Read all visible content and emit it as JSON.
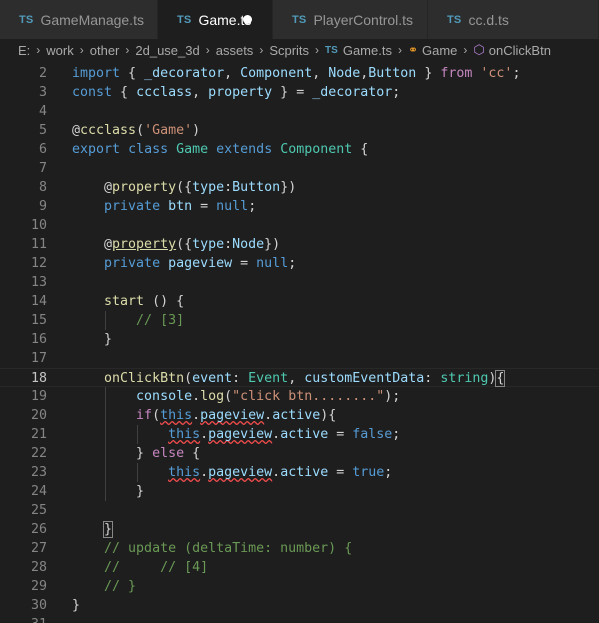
{
  "tabs": [
    {
      "type": "TS",
      "label": "GameManage.ts",
      "active": false,
      "modified": false
    },
    {
      "type": "TS",
      "label": "Game.ts",
      "active": true,
      "modified": true
    },
    {
      "type": "TS",
      "label": "PlayerControl.ts",
      "active": false,
      "modified": false
    },
    {
      "type": "TS",
      "label": "cc.d.ts",
      "active": false,
      "modified": false
    }
  ],
  "breadcrumb": [
    "E:",
    "work",
    "other",
    "2d_use_3d",
    "assets",
    "Scprits",
    "Game.ts",
    "Game",
    "onClickBtn"
  ],
  "colors": {
    "keyword": "#569cd6",
    "control": "#c586c0",
    "string": "#ce9178",
    "variable": "#9cdcfe",
    "type": "#4ec9b0",
    "function": "#dcdcaa",
    "comment": "#6a9955",
    "text": "#d4d4d4",
    "background": "#1e1e1e"
  },
  "editor": {
    "current_line": 18,
    "lines": [
      {
        "n": 2,
        "tokens": [
          [
            "k",
            "import"
          ],
          [
            "p",
            " { "
          ],
          [
            "v",
            "_decorator"
          ],
          [
            "p",
            ", "
          ],
          [
            "v",
            "Component"
          ],
          [
            "p",
            ", "
          ],
          [
            "v",
            "Node"
          ],
          [
            "p",
            ","
          ],
          [
            "v",
            "Button"
          ],
          [
            "p",
            " } "
          ],
          [
            "kc",
            "from"
          ],
          [
            "p",
            " "
          ],
          [
            "s",
            "'cc'"
          ],
          [
            "p",
            ";"
          ]
        ]
      },
      {
        "n": 3,
        "tokens": [
          [
            "k",
            "const"
          ],
          [
            "p",
            " { "
          ],
          [
            "v",
            "ccclass"
          ],
          [
            "p",
            ", "
          ],
          [
            "v",
            "property"
          ],
          [
            "p",
            " } = "
          ],
          [
            "v",
            "_decorator"
          ],
          [
            "p",
            ";"
          ]
        ]
      },
      {
        "n": 4,
        "tokens": []
      },
      {
        "n": 5,
        "tokens": [
          [
            "p",
            "@"
          ],
          [
            "f",
            "ccclass"
          ],
          [
            "p",
            "("
          ],
          [
            "s",
            "'Game'"
          ],
          [
            "p",
            ")"
          ]
        ]
      },
      {
        "n": 6,
        "tokens": [
          [
            "k",
            "export"
          ],
          [
            "p",
            " "
          ],
          [
            "k",
            "class"
          ],
          [
            "p",
            " "
          ],
          [
            "t",
            "Game"
          ],
          [
            "p",
            " "
          ],
          [
            "k",
            "extends"
          ],
          [
            "p",
            " "
          ],
          [
            "t",
            "Component"
          ],
          [
            "p",
            " {"
          ]
        ]
      },
      {
        "n": 7,
        "tokens": []
      },
      {
        "n": 8,
        "tokens": [
          [
            "p",
            "    @"
          ],
          [
            "f",
            "property"
          ],
          [
            "p",
            "({"
          ],
          [
            "v",
            "type"
          ],
          [
            "p",
            ":"
          ],
          [
            "v",
            "Button"
          ],
          [
            "p",
            "})"
          ]
        ]
      },
      {
        "n": 9,
        "tokens": [
          [
            "p",
            "    "
          ],
          [
            "k",
            "private"
          ],
          [
            "p",
            " "
          ],
          [
            "v",
            "btn"
          ],
          [
            "p",
            " = "
          ],
          [
            "k",
            "null"
          ],
          [
            "p",
            ";"
          ]
        ]
      },
      {
        "n": 10,
        "tokens": []
      },
      {
        "n": 11,
        "tokens": [
          [
            "p",
            "    @"
          ],
          [
            "fu",
            "property"
          ],
          [
            "p",
            "({"
          ],
          [
            "v",
            "type"
          ],
          [
            "p",
            ":"
          ],
          [
            "v",
            "Node"
          ],
          [
            "p",
            "})"
          ]
        ]
      },
      {
        "n": 12,
        "tokens": [
          [
            "p",
            "    "
          ],
          [
            "k",
            "private"
          ],
          [
            "p",
            " "
          ],
          [
            "v",
            "pageview"
          ],
          [
            "p",
            " = "
          ],
          [
            "k",
            "null"
          ],
          [
            "p",
            ";"
          ]
        ]
      },
      {
        "n": 13,
        "tokens": []
      },
      {
        "n": 14,
        "tokens": [
          [
            "p",
            "    "
          ],
          [
            "f",
            "start"
          ],
          [
            "p",
            " () {"
          ]
        ]
      },
      {
        "n": 15,
        "tokens": [
          [
            "p",
            "        "
          ],
          [
            "c",
            "// [3]"
          ]
        ]
      },
      {
        "n": 16,
        "tokens": [
          [
            "p",
            "    }"
          ]
        ]
      },
      {
        "n": 17,
        "tokens": []
      },
      {
        "n": 18,
        "tokens": [
          [
            "p",
            "    "
          ],
          [
            "f",
            "onClickBtn"
          ],
          [
            "p",
            "("
          ],
          [
            "v",
            "event"
          ],
          [
            "p",
            ": "
          ],
          [
            "t",
            "Event"
          ],
          [
            "p",
            ", "
          ],
          [
            "v",
            "customEventData"
          ],
          [
            "p",
            ": "
          ],
          [
            "t",
            "string"
          ],
          [
            "p",
            ")"
          ],
          [
            "pb",
            "{"
          ]
        ]
      },
      {
        "n": 19,
        "tokens": [
          [
            "p",
            "        "
          ],
          [
            "v",
            "console"
          ],
          [
            "p",
            "."
          ],
          [
            "f",
            "log"
          ],
          [
            "p",
            "("
          ],
          [
            "s",
            "\"click btn........\""
          ],
          [
            "p",
            ");"
          ]
        ]
      },
      {
        "n": 20,
        "tokens": [
          [
            "p",
            "        "
          ],
          [
            "kc",
            "if"
          ],
          [
            "p",
            "("
          ],
          [
            "kq",
            "this"
          ],
          [
            "p",
            "."
          ],
          [
            "vq",
            "pageview"
          ],
          [
            "p",
            "."
          ],
          [
            "v",
            "active"
          ],
          [
            "p",
            "){"
          ]
        ]
      },
      {
        "n": 21,
        "tokens": [
          [
            "p",
            "            "
          ],
          [
            "kq",
            "this"
          ],
          [
            "p",
            "."
          ],
          [
            "vq",
            "pageview"
          ],
          [
            "p",
            "."
          ],
          [
            "v",
            "active"
          ],
          [
            "p",
            " = "
          ],
          [
            "k",
            "false"
          ],
          [
            "p",
            ";"
          ]
        ]
      },
      {
        "n": 22,
        "tokens": [
          [
            "p",
            "        } "
          ],
          [
            "kc",
            "else"
          ],
          [
            "p",
            " {"
          ]
        ]
      },
      {
        "n": 23,
        "tokens": [
          [
            "p",
            "            "
          ],
          [
            "kq",
            "this"
          ],
          [
            "p",
            "."
          ],
          [
            "vq",
            "pageview"
          ],
          [
            "p",
            "."
          ],
          [
            "v",
            "active"
          ],
          [
            "p",
            " = "
          ],
          [
            "k",
            "true"
          ],
          [
            "p",
            ";"
          ]
        ]
      },
      {
        "n": 24,
        "tokens": [
          [
            "p",
            "        }"
          ]
        ]
      },
      {
        "n": 25,
        "tokens": []
      },
      {
        "n": 26,
        "tokens": [
          [
            "p",
            "    "
          ],
          [
            "pb",
            "}"
          ]
        ]
      },
      {
        "n": 27,
        "tokens": [
          [
            "p",
            "    "
          ],
          [
            "c",
            "// update (deltaTime: number) {"
          ]
        ]
      },
      {
        "n": 28,
        "tokens": [
          [
            "p",
            "    "
          ],
          [
            "c",
            "//     // [4]"
          ]
        ]
      },
      {
        "n": 29,
        "tokens": [
          [
            "p",
            "    "
          ],
          [
            "c",
            "// }"
          ]
        ]
      },
      {
        "n": 30,
        "tokens": [
          [
            "p",
            "}"
          ]
        ]
      },
      {
        "n": 31,
        "tokens": []
      }
    ]
  }
}
